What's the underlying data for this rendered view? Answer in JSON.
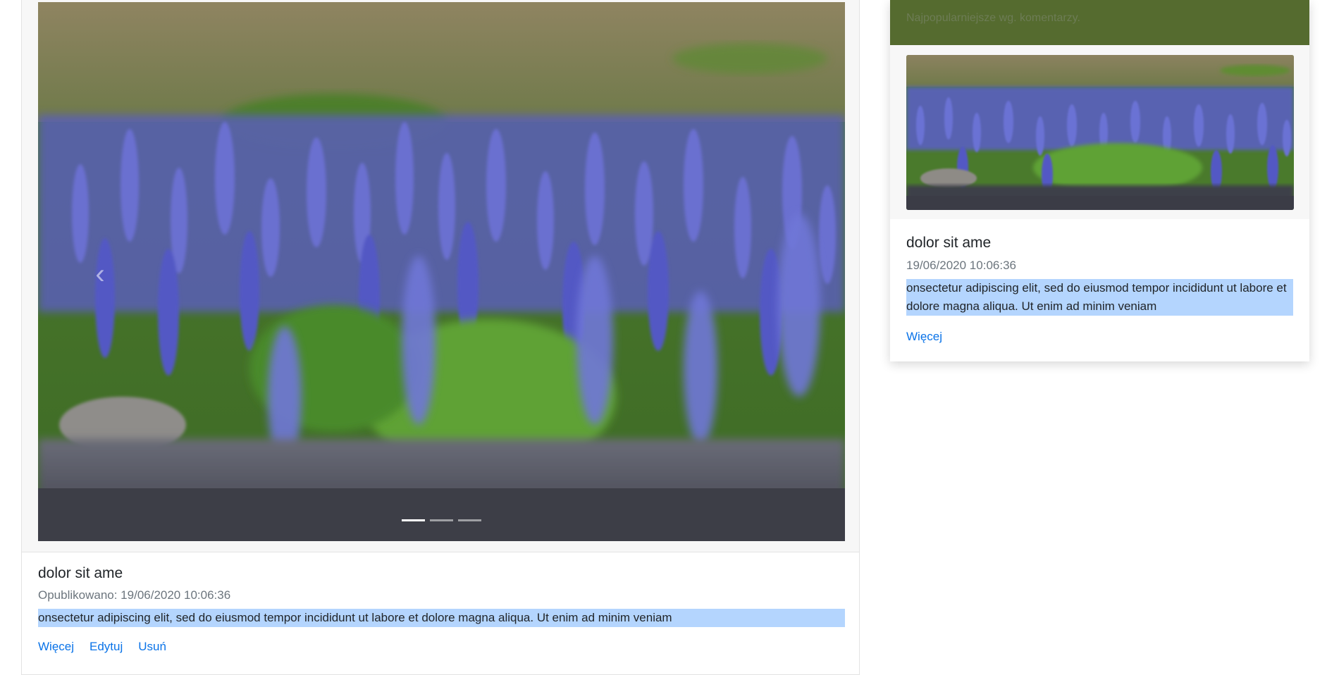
{
  "carousel": {
    "prev_icon": "chevron-left-icon",
    "indicators": 3,
    "active_index": 0
  },
  "main_post": {
    "title": "dolor sit ame",
    "meta": "Opublikowano: 19/06/2020 10:06:36",
    "excerpt": "onsectetur adipiscing elit, sed do eiusmod tempor incididunt ut labore et dolore magna aliqua. Ut enim ad minim veniam",
    "links": {
      "more": "Więcej",
      "edit": "Edytuj",
      "delete": "Usuń"
    }
  },
  "sidebar": {
    "header": "Najpopularniejsze wg. komentarzy.",
    "post": {
      "title": "dolor sit ame",
      "date": "19/06/2020 10:06:36",
      "excerpt": "onsectetur adipiscing elit, sed do eiusmod tempor incididunt ut labore et dolore magna aliqua. Ut enim ad minim veniam",
      "more": "Więcej"
    }
  },
  "colors": {
    "sidebar_header_bg": "#556b2f",
    "link": "#0a73e8",
    "selection": "#b4d5fe"
  }
}
